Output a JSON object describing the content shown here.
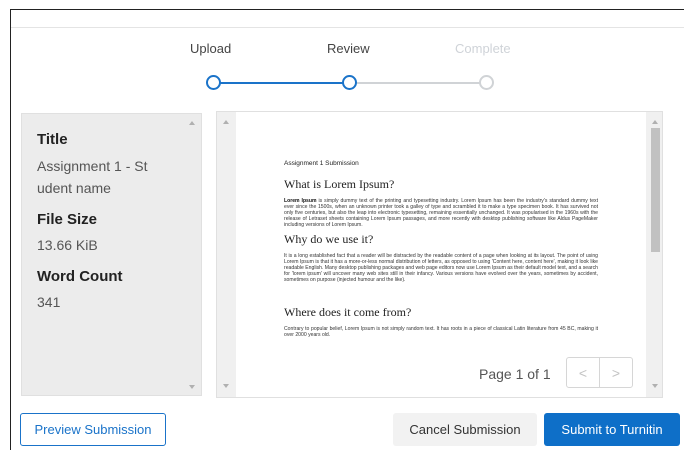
{
  "stepper": {
    "steps": [
      {
        "label": "Upload",
        "state": "done"
      },
      {
        "label": "Review",
        "state": "current"
      },
      {
        "label": "Complete",
        "state": "pending"
      }
    ],
    "active_color": "#1a73c9",
    "inactive_color": "#d0d3d6"
  },
  "meta": {
    "title_label": "Title",
    "title_value_1": "Assignment 1 - St",
    "title_value_2": "udent name",
    "filesize_label": "File Size",
    "filesize_value": "13.66 KiB",
    "wordcount_label": "Word Count",
    "wordcount_value": "341"
  },
  "document": {
    "caption": "Assignment 1 Submission",
    "heading_1": "What is Lorem Ipsum?",
    "para_1_bold": "Lorem Ipsum",
    "para_1": " is simply dummy text of the printing and typesetting industry. Lorem Ipsum has been the industry's standard dummy text ever since the 1500s, when an unknown printer took a galley of type and scrambled it to make a type specimen book. It has survived not only five centuries, but also the leap into electronic typesetting, remaining essentially unchanged. It was popularised in the 1960s with the release of Letraset sheets containing Lorem Ipsum passages, and more recently with desktop publishing software like Aldus PageMaker including versions of Lorem Ipsum.",
    "heading_2": "Why do we use it?",
    "para_2": "It is a long established fact that a reader will be distracted by the readable content of a page when looking at its layout. The point of using Lorem Ipsum is that it has a more-or-less normal distribution of letters, as opposed to using 'Content here, content here', making it look like readable English. Many desktop publishing packages and web page editors now use Lorem Ipsum as their default model text, and a search for 'lorem ipsum' will uncover many web sites still in their infancy. Various versions have evolved over the years, sometimes by accident, sometimes on purpose (injected humour and the like).",
    "heading_3": "Where does it come from?",
    "para_3": "Contrary to popular belief, Lorem Ipsum is not simply random text. It has roots in a piece of classical Latin literature from 45 BC, making it over 2000 years old."
  },
  "pager": {
    "indicator": "Page 1 of 1",
    "prev_icon": "<",
    "next_icon": ">"
  },
  "actions": {
    "preview_label": "Preview Submission",
    "cancel_label": "Cancel Submission",
    "submit_label": "Submit to Turnitin"
  },
  "colors": {
    "primary": "#0e6fc8",
    "panel_bg": "#ececec"
  }
}
